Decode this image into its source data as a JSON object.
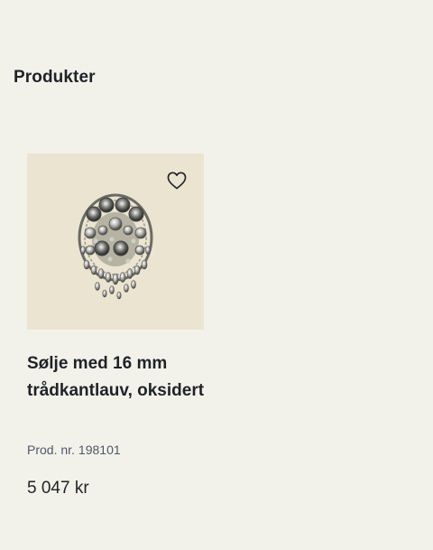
{
  "section": {
    "title": "Produkter"
  },
  "product": {
    "name": "Sølje med 16 mm trådkantlauv, oksidert",
    "number_label": "Prod. nr.",
    "number": "198101",
    "price": "5 047 kr",
    "image_icon": "brooch-image",
    "favorite_icon": "heart-outline-icon"
  },
  "colors": {
    "page_background": "#f3f2ea",
    "image_background": "#ebe4d0",
    "text": "#1f2228",
    "muted_text": "#4f566a"
  }
}
